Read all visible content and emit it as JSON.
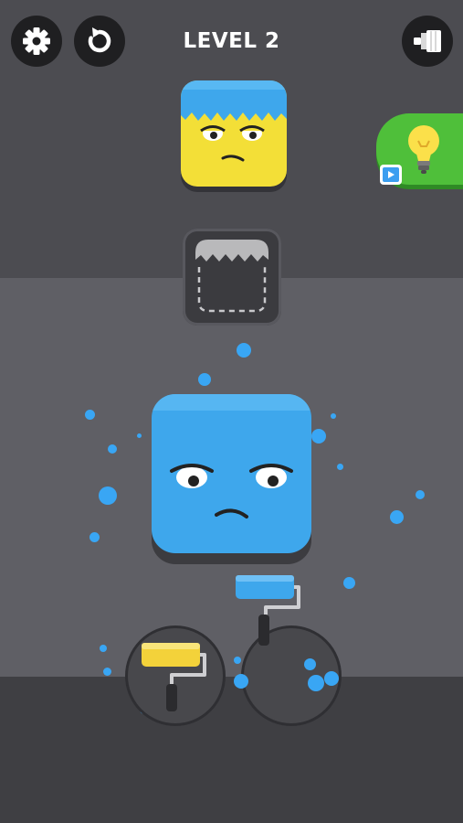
{
  "header": {
    "level_label": "LEVEL 2",
    "settings_icon": "gear-icon",
    "restart_icon": "restart-icon",
    "paint_icon": "paint-brush-icon"
  },
  "target_block": {
    "body_color": "#f3df37",
    "hair_color": "#3ea7ec",
    "face": "bored-face"
  },
  "hint_button": {
    "icon": "lightbulb-icon",
    "badge_icon": "video-ad-icon",
    "color": "#4fbf3a"
  },
  "stamp_slot": {
    "icon": "zigzag-cutter-icon"
  },
  "player_block": {
    "color": "#3ea7ec",
    "face": "bored-face"
  },
  "rollers": [
    {
      "color": "#f3d23a",
      "icon": "paint-roller-icon"
    },
    {
      "color": "#3ea7ec",
      "icon": "paint-roller-icon"
    }
  ],
  "colors": {
    "paint_splatter": "#39a6f4",
    "top_band": "#4c4c51",
    "middle_band": "#5f5f65",
    "bottom_band": "#3f3f43"
  }
}
